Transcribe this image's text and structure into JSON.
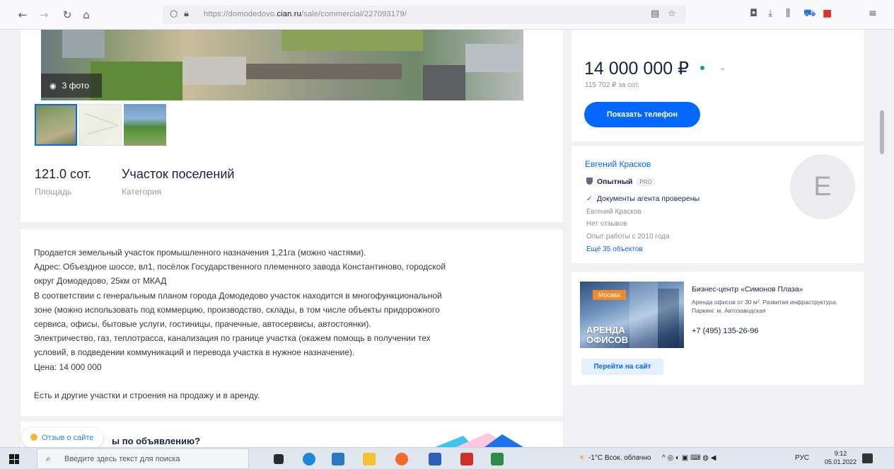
{
  "browser": {
    "url_prefix": "https://domodedovo.",
    "url_domain": "cian.ru",
    "url_path": "/sale/commercial/227093179/",
    "icons": [
      "back-icon",
      "forward-icon",
      "reload-icon",
      "home-icon",
      "shield-icon",
      "lock-icon",
      "reader-icon",
      "star-icon",
      "pocket-icon",
      "download-icon",
      "library-icon",
      "cart-icon",
      "extension-icon",
      "menu-icon"
    ]
  },
  "gallery": {
    "photo_count": "3 фото"
  },
  "stats": [
    {
      "value": "121.0 сот.",
      "label": "Площадь"
    },
    {
      "value": "Участок поселений",
      "label": "Категория"
    }
  ],
  "description": {
    "lines": [
      "Продается земельный участок промышленного назначения 1,21га (можно частями).",
      "Адрес: Объездное шоссе, вл1, посёлок Государственного племенного завода Константиново, городской",
      "округ Домодедово, 25км от МКАД",
      "В соответствии с генеральным планом города Домодедово участок находится в многофункциональной",
      "зоне (можно использовать под коммерцию, производство, склады, в том числе объекты придорожного",
      "сервиса, офисы, бытовые услуги, гостиницы, прачечные, автосервисы, автостоянки).",
      "Электричество, газ, теплотрасса, канализация по границе участка (окажем помощь в получении тех",
      "условий, в подведении коммуникаций и перевода участка в нужное назначение).",
      "Цена: 14 000 000"
    ],
    "extra": "Есть и другие участки и строения на продажу и в аренду."
  },
  "questions_title": "ы по объявлению?",
  "feedback_label": "Отзыв о сайте",
  "offer": {
    "price": "14 000 000 ₽",
    "price_per_unit": "115 702 ₽ за сот.",
    "show_phone": "Показать телефон"
  },
  "agent": {
    "name": "Евгений Красков",
    "status": "Опытный",
    "status_badge": "PRO",
    "verified": "Документы агента проверены",
    "meta": [
      "Евгений Красков",
      "Нет отзывов",
      "Опыт работы с 2010 года"
    ],
    "more_link": "Ещё 35 объектов",
    "avatar_letter": "E"
  },
  "ad": {
    "tag": "Москва",
    "image_text_1": "АРЕНДА",
    "image_text_2": "ОФИСОВ",
    "title": "Бизнес-центр «Симонов Плаза»",
    "desc": "Аренда офисов от 30 м². Развитая инфраструктура. Паркинг. м. Автозаводская",
    "phone": "+7 (495) 135-26-96",
    "button": "Перейти на сайт"
  },
  "taskbar": {
    "search_placeholder": "Введите здесь текст для поиска",
    "weather": "-1°C Всок. облачно",
    "lang": "РУС",
    "time": "9:12",
    "date": "05.01.2022"
  },
  "colors": {
    "accent": "#0468ff",
    "price_indicator": "#1fa363",
    "ad_tag": "#f08a2a"
  }
}
